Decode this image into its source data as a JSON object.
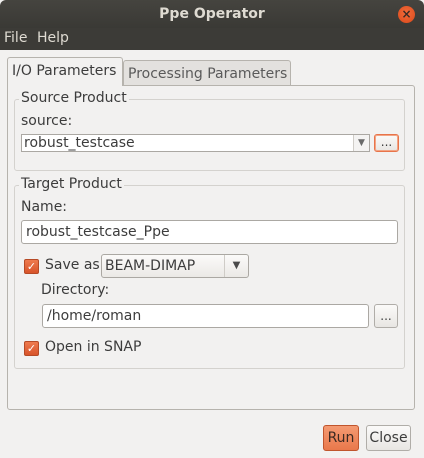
{
  "window": {
    "title": "Ppe Operator",
    "close_glyph": "×"
  },
  "menu": [
    {
      "label": "File"
    },
    {
      "label": "Help"
    }
  ],
  "tabs": [
    {
      "label": "I/O Parameters",
      "active": true
    },
    {
      "label": "Processing Parameters",
      "active": false
    }
  ],
  "source_product": {
    "group_title": "Source Product",
    "source_label": "source:",
    "source_value": "robust_testcase",
    "browse_label": "..."
  },
  "target_product": {
    "group_title": "Target Product",
    "name_label": "Name:",
    "name_value": "robust_testcase_Ppe",
    "save_as_label": "Save as:",
    "save_as_checked": true,
    "format_value": "BEAM-DIMAP",
    "directory_label": "Directory:",
    "directory_value": "/home/roman",
    "directory_browse_label": "...",
    "open_in_snap_label": "Open in SNAP",
    "open_in_snap_checked": true
  },
  "buttons": {
    "run": "Run",
    "close": "Close"
  },
  "colors": {
    "accent": "#e9784b",
    "titlebar": "#3c3b37"
  }
}
